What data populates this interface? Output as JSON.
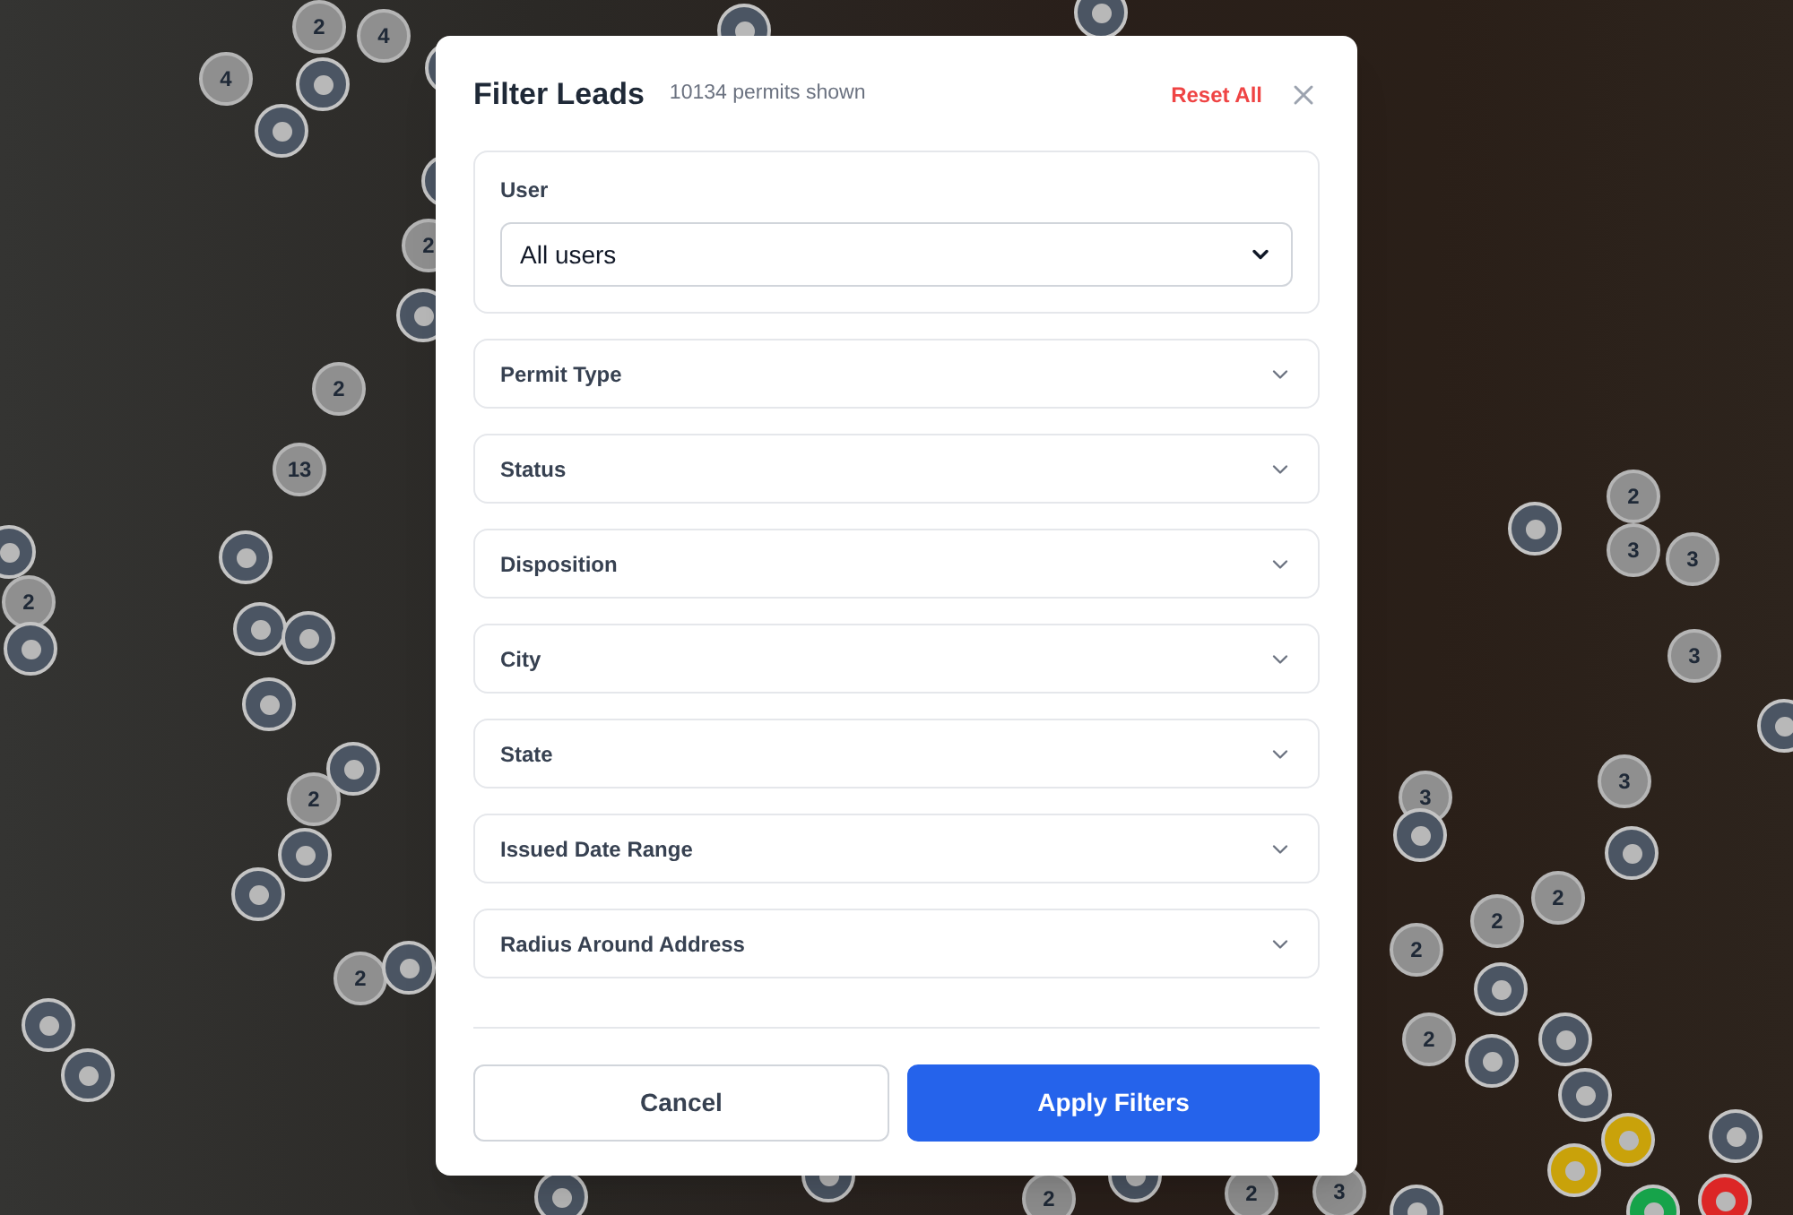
{
  "map": {
    "markers": [
      {
        "kind": "cluster",
        "label": "2"
      },
      {
        "kind": "cluster",
        "label": "4"
      },
      {
        "kind": "cluster",
        "label": "4"
      },
      {
        "kind": "cluster",
        "label": "2"
      },
      {
        "kind": "cluster",
        "label": "2"
      },
      {
        "kind": "cluster",
        "label": "13"
      },
      {
        "kind": "cluster",
        "label": "2"
      },
      {
        "kind": "cluster",
        "label": "2"
      },
      {
        "kind": "cluster",
        "label": "2"
      },
      {
        "kind": "cluster",
        "label": "2"
      },
      {
        "kind": "cluster",
        "label": "3"
      },
      {
        "kind": "cluster",
        "label": "3"
      },
      {
        "kind": "cluster",
        "label": "3"
      },
      {
        "kind": "cluster",
        "label": "3"
      },
      {
        "kind": "cluster",
        "label": "3"
      },
      {
        "kind": "cluster",
        "label": "2"
      },
      {
        "kind": "cluster",
        "label": "2"
      },
      {
        "kind": "cluster",
        "label": "2"
      },
      {
        "kind": "cluster",
        "label": "2"
      },
      {
        "kind": "cluster",
        "label": "2"
      },
      {
        "kind": "cluster",
        "label": "2"
      },
      {
        "kind": "cluster",
        "label": "3"
      },
      {
        "kind": "dot",
        "color": "#4b5563"
      },
      {
        "kind": "dot",
        "color": "#4b5563"
      },
      {
        "kind": "dot",
        "color": "#4b5563"
      },
      {
        "kind": "dot",
        "color": "#4b5563"
      },
      {
        "kind": "dot",
        "color": "#4b5563"
      },
      {
        "kind": "dot",
        "color": "#4b5563"
      },
      {
        "kind": "dot",
        "color": "#4b5563"
      },
      {
        "kind": "dot",
        "color": "#4b5563"
      },
      {
        "kind": "dot",
        "color": "#4b5563"
      },
      {
        "kind": "dot",
        "color": "#4b5563"
      },
      {
        "kind": "dot",
        "color": "#4b5563"
      },
      {
        "kind": "dot",
        "color": "#4b5563"
      },
      {
        "kind": "dot",
        "color": "#4b5563"
      },
      {
        "kind": "dot",
        "color": "#4b5563"
      },
      {
        "kind": "dot",
        "color": "#4b5563"
      },
      {
        "kind": "dot",
        "color": "#4b5563"
      },
      {
        "kind": "dot",
        "color": "#4b5563"
      },
      {
        "kind": "dot",
        "color": "#4b5563"
      },
      {
        "kind": "dot",
        "color": "#4b5563"
      },
      {
        "kind": "dot",
        "color": "#4b5563"
      },
      {
        "kind": "dot",
        "color": "#4b5563"
      },
      {
        "kind": "dot",
        "color": "#4b5563"
      },
      {
        "kind": "dot",
        "color": "#4b5563"
      },
      {
        "kind": "dot",
        "color": "#4b5563"
      },
      {
        "kind": "dot",
        "color": "#4b5563"
      },
      {
        "kind": "dot",
        "color": "#4b5563"
      },
      {
        "kind": "dot",
        "color": "#4b5563"
      },
      {
        "kind": "dot",
        "color": "#4b5563"
      },
      {
        "kind": "dot",
        "color": "#4b5563"
      },
      {
        "kind": "dot",
        "color": "#4b5563"
      },
      {
        "kind": "dot",
        "color": "#4b5563"
      },
      {
        "kind": "dot",
        "color": "#4b5563"
      },
      {
        "kind": "dot",
        "color": "#c9a20a"
      },
      {
        "kind": "dot",
        "color": "#c9a20a"
      },
      {
        "kind": "dot",
        "color": "#16a34a"
      },
      {
        "kind": "dot",
        "color": "#dc2626"
      }
    ]
  },
  "dialog": {
    "title": "Filter Leads",
    "count": "10134 permits shown",
    "reset": "Reset All",
    "user": {
      "label": "User",
      "value": "All users"
    },
    "sections": [
      {
        "label": "Permit Type",
        "expanded": false
      },
      {
        "label": "Status",
        "expanded": false
      },
      {
        "label": "Disposition",
        "expanded": false
      },
      {
        "label": "City",
        "expanded": false
      },
      {
        "label": "State",
        "expanded": false
      },
      {
        "label": "Issued Date Range",
        "expanded": false
      },
      {
        "label": "Radius Around Address",
        "expanded": false
      }
    ],
    "buttons": {
      "cancel": "Cancel",
      "apply": "Apply Filters"
    }
  }
}
